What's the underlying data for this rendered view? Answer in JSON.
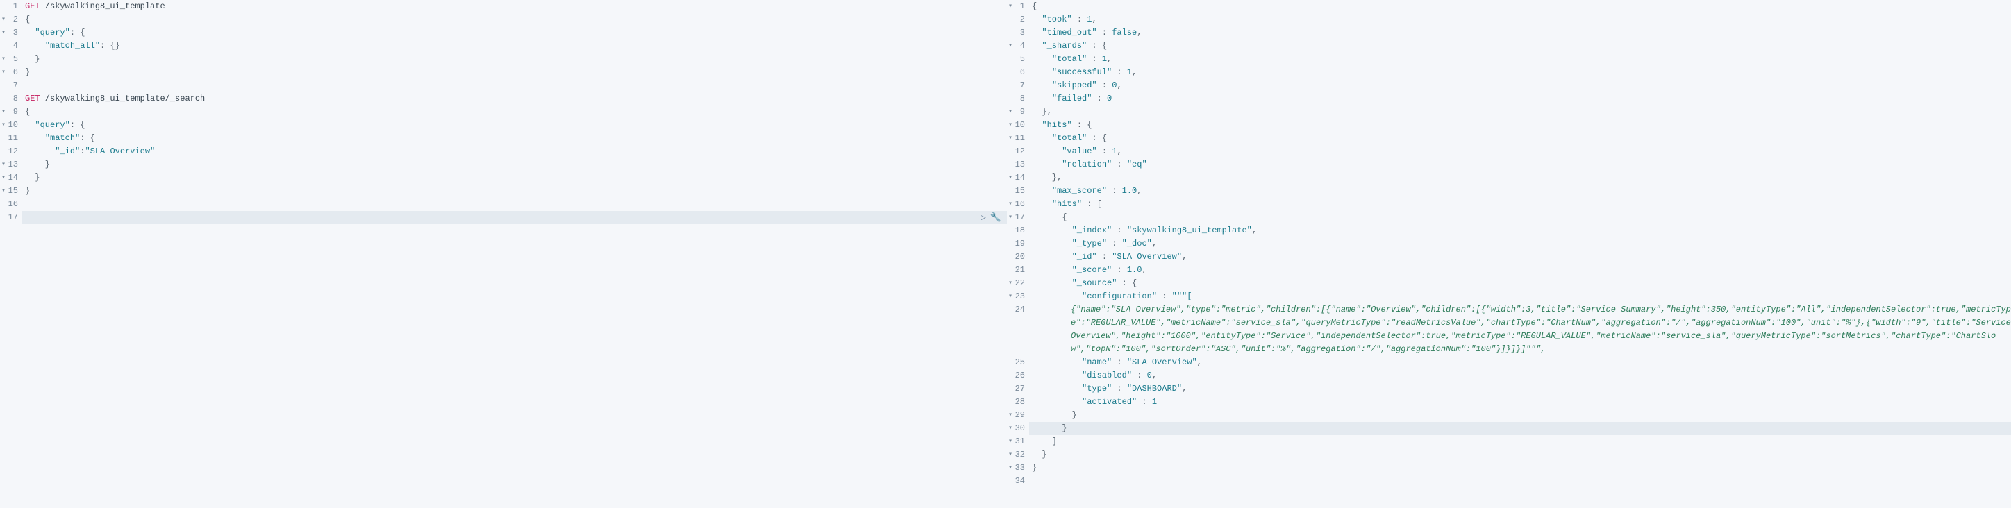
{
  "left": {
    "lines": [
      {
        "n": "1",
        "fold": "",
        "t": [
          [
            "method",
            "GET"
          ],
          [
            "path",
            " /skywalking8_ui_template"
          ]
        ]
      },
      {
        "n": "2",
        "fold": "▾",
        "t": [
          [
            "punct",
            "{"
          ]
        ]
      },
      {
        "n": "3",
        "fold": "▾",
        "t": [
          [
            "punct",
            "  "
          ],
          [
            "key",
            "\"query\""
          ],
          [
            "punct",
            ": {"
          ]
        ]
      },
      {
        "n": "4",
        "fold": "",
        "t": [
          [
            "punct",
            "    "
          ],
          [
            "key",
            "\"match_all\""
          ],
          [
            "punct",
            ": {}"
          ]
        ]
      },
      {
        "n": "5",
        "fold": "▾",
        "t": [
          [
            "punct",
            "  }"
          ]
        ]
      },
      {
        "n": "6",
        "fold": "▾",
        "t": [
          [
            "punct",
            "}"
          ]
        ]
      },
      {
        "n": "7",
        "fold": "",
        "t": []
      },
      {
        "n": "8",
        "fold": "",
        "t": [
          [
            "method",
            "GET"
          ],
          [
            "path",
            " /skywalking8_ui_template/_search"
          ]
        ]
      },
      {
        "n": "9",
        "fold": "▾",
        "t": [
          [
            "punct",
            "{"
          ]
        ]
      },
      {
        "n": "10",
        "fold": "▾",
        "t": [
          [
            "punct",
            "  "
          ],
          [
            "key",
            "\"query\""
          ],
          [
            "punct",
            ": {"
          ]
        ]
      },
      {
        "n": "11",
        "fold": "",
        "t": [
          [
            "punct",
            "    "
          ],
          [
            "key",
            "\"match\""
          ],
          [
            "punct",
            ": {"
          ]
        ]
      },
      {
        "n": "12",
        "fold": "",
        "t": [
          [
            "punct",
            "      "
          ],
          [
            "key",
            "\"_id\""
          ],
          [
            "punct",
            ":"
          ],
          [
            "string",
            "\"SLA Overview\""
          ]
        ]
      },
      {
        "n": "13",
        "fold": "▾",
        "t": [
          [
            "punct",
            "    }"
          ]
        ]
      },
      {
        "n": "14",
        "fold": "▾",
        "t": [
          [
            "punct",
            "  }"
          ]
        ]
      },
      {
        "n": "15",
        "fold": "▾",
        "t": [
          [
            "punct",
            "}"
          ]
        ]
      },
      {
        "n": "16",
        "fold": "",
        "t": []
      },
      {
        "n": "17",
        "fold": "",
        "t": []
      }
    ],
    "actions": {
      "play": "▷",
      "wrench": "🔧"
    }
  },
  "right": {
    "lines": [
      {
        "n": "1",
        "fold": "▾",
        "t": [
          [
            "punct",
            "{"
          ]
        ]
      },
      {
        "n": "2",
        "fold": "",
        "t": [
          [
            "punct",
            "  "
          ],
          [
            "key",
            "\"took\""
          ],
          [
            "punct",
            " : "
          ],
          [
            "num",
            "1"
          ],
          [
            "punct",
            ","
          ]
        ]
      },
      {
        "n": "3",
        "fold": "",
        "t": [
          [
            "punct",
            "  "
          ],
          [
            "key",
            "\"timed_out\""
          ],
          [
            "punct",
            " : "
          ],
          [
            "bool",
            "false"
          ],
          [
            "punct",
            ","
          ]
        ]
      },
      {
        "n": "4",
        "fold": "▾",
        "t": [
          [
            "punct",
            "  "
          ],
          [
            "key",
            "\"_shards\""
          ],
          [
            "punct",
            " : {"
          ]
        ]
      },
      {
        "n": "5",
        "fold": "",
        "t": [
          [
            "punct",
            "    "
          ],
          [
            "key",
            "\"total\""
          ],
          [
            "punct",
            " : "
          ],
          [
            "num",
            "1"
          ],
          [
            "punct",
            ","
          ]
        ]
      },
      {
        "n": "6",
        "fold": "",
        "t": [
          [
            "punct",
            "    "
          ],
          [
            "key",
            "\"successful\""
          ],
          [
            "punct",
            " : "
          ],
          [
            "num",
            "1"
          ],
          [
            "punct",
            ","
          ]
        ]
      },
      {
        "n": "7",
        "fold": "",
        "t": [
          [
            "punct",
            "    "
          ],
          [
            "key",
            "\"skipped\""
          ],
          [
            "punct",
            " : "
          ],
          [
            "num",
            "0"
          ],
          [
            "punct",
            ","
          ]
        ]
      },
      {
        "n": "8",
        "fold": "",
        "t": [
          [
            "punct",
            "    "
          ],
          [
            "key",
            "\"failed\""
          ],
          [
            "punct",
            " : "
          ],
          [
            "num",
            "0"
          ]
        ]
      },
      {
        "n": "9",
        "fold": "▾",
        "t": [
          [
            "punct",
            "  },"
          ]
        ]
      },
      {
        "n": "10",
        "fold": "▾",
        "t": [
          [
            "punct",
            "  "
          ],
          [
            "key",
            "\"hits\""
          ],
          [
            "punct",
            " : {"
          ]
        ]
      },
      {
        "n": "11",
        "fold": "▾",
        "t": [
          [
            "punct",
            "    "
          ],
          [
            "key",
            "\"total\""
          ],
          [
            "punct",
            " : {"
          ]
        ]
      },
      {
        "n": "12",
        "fold": "",
        "t": [
          [
            "punct",
            "      "
          ],
          [
            "key",
            "\"value\""
          ],
          [
            "punct",
            " : "
          ],
          [
            "num",
            "1"
          ],
          [
            "punct",
            ","
          ]
        ]
      },
      {
        "n": "13",
        "fold": "",
        "t": [
          [
            "punct",
            "      "
          ],
          [
            "key",
            "\"relation\""
          ],
          [
            "punct",
            " : "
          ],
          [
            "string",
            "\"eq\""
          ]
        ]
      },
      {
        "n": "14",
        "fold": "▾",
        "t": [
          [
            "punct",
            "    },"
          ]
        ]
      },
      {
        "n": "15",
        "fold": "",
        "t": [
          [
            "punct",
            "    "
          ],
          [
            "key",
            "\"max_score\""
          ],
          [
            "punct",
            " : "
          ],
          [
            "num",
            "1.0"
          ],
          [
            "punct",
            ","
          ]
        ]
      },
      {
        "n": "16",
        "fold": "▾",
        "t": [
          [
            "punct",
            "    "
          ],
          [
            "key",
            "\"hits\""
          ],
          [
            "punct",
            " : ["
          ]
        ]
      },
      {
        "n": "17",
        "fold": "▾",
        "t": [
          [
            "punct",
            "      {"
          ]
        ]
      },
      {
        "n": "18",
        "fold": "",
        "t": [
          [
            "punct",
            "        "
          ],
          [
            "key",
            "\"_index\""
          ],
          [
            "punct",
            " : "
          ],
          [
            "string",
            "\"skywalking8_ui_template\""
          ],
          [
            "punct",
            ","
          ]
        ]
      },
      {
        "n": "19",
        "fold": "",
        "t": [
          [
            "punct",
            "        "
          ],
          [
            "key",
            "\"_type\""
          ],
          [
            "punct",
            " : "
          ],
          [
            "string",
            "\"_doc\""
          ],
          [
            "punct",
            ","
          ]
        ]
      },
      {
        "n": "20",
        "fold": "",
        "t": [
          [
            "punct",
            "        "
          ],
          [
            "key",
            "\"_id\""
          ],
          [
            "punct",
            " : "
          ],
          [
            "string",
            "\"SLA Overview\""
          ],
          [
            "punct",
            ","
          ]
        ]
      },
      {
        "n": "21",
        "fold": "",
        "t": [
          [
            "punct",
            "        "
          ],
          [
            "key",
            "\"_score\""
          ],
          [
            "punct",
            " : "
          ],
          [
            "num",
            "1.0"
          ],
          [
            "punct",
            ","
          ]
        ]
      },
      {
        "n": "22",
        "fold": "▾",
        "t": [
          [
            "punct",
            "        "
          ],
          [
            "key",
            "\"_source\""
          ],
          [
            "punct",
            " : {"
          ]
        ]
      },
      {
        "n": "23",
        "fold": "▾",
        "t": [
          [
            "punct",
            "          "
          ],
          [
            "key",
            "\"configuration\""
          ],
          [
            "punct",
            " : "
          ],
          [
            "string",
            "\"\"\"["
          ]
        ]
      },
      {
        "n": "24",
        "fold": "",
        "wrap": true,
        "t": [
          [
            "italic-green",
            "{\"name\":\"SLA Overview\",\"type\":\"metric\",\"children\":[{\"name\":\"Overview\",\"children\":[{\"width\":3,\"title\":\"Service Summary\",\"height\":350,\"entityType\":\"All\",\"independentSelector\":true,\"metricType\":\"REGULAR_VALUE\",\"metricName\":\"service_sla\",\"queryMetricType\":\"readMetricsValue\",\"chartType\":\"ChartNum\",\"aggregation\":\"/\",\"aggregationNum\":\"100\",\"unit\":\"%\"},{\"width\":\"9\",\"title\":\"Service Overview\",\"height\":\"1000\",\"entityType\":\"Service\",\"independentSelector\":true,\"metricType\":\"REGULAR_VALUE\",\"metricName\":\"service_sla\",\"queryMetricType\":\"sortMetrics\",\"chartType\":\"ChartSlow\",\"topN\":\"100\",\"sortOrder\":\"ASC\",\"unit\":\"%\",\"aggregation\":\"/\",\"aggregationNum\":\"100\"}]}]}]\"\"\","
          ]
        ]
      },
      {
        "n": "25",
        "fold": "",
        "t": [
          [
            "punct",
            "          "
          ],
          [
            "key",
            "\"name\""
          ],
          [
            "punct",
            " : "
          ],
          [
            "string",
            "\"SLA Overview\""
          ],
          [
            "punct",
            ","
          ]
        ]
      },
      {
        "n": "26",
        "fold": "",
        "t": [
          [
            "punct",
            "          "
          ],
          [
            "key",
            "\"disabled\""
          ],
          [
            "punct",
            " : "
          ],
          [
            "num",
            "0"
          ],
          [
            "punct",
            ","
          ]
        ]
      },
      {
        "n": "27",
        "fold": "",
        "t": [
          [
            "punct",
            "          "
          ],
          [
            "key",
            "\"type\""
          ],
          [
            "punct",
            " : "
          ],
          [
            "string",
            "\"DASHBOARD\""
          ],
          [
            "punct",
            ","
          ]
        ]
      },
      {
        "n": "28",
        "fold": "",
        "t": [
          [
            "punct",
            "          "
          ],
          [
            "key",
            "\"activated\""
          ],
          [
            "punct",
            " : "
          ],
          [
            "num",
            "1"
          ]
        ]
      },
      {
        "n": "29",
        "fold": "▾",
        "t": [
          [
            "punct",
            "        }"
          ]
        ]
      },
      {
        "n": "30",
        "fold": "▾",
        "t": [
          [
            "punct",
            "      }"
          ]
        ]
      },
      {
        "n": "31",
        "fold": "▾",
        "t": [
          [
            "punct",
            "    ]"
          ]
        ]
      },
      {
        "n": "32",
        "fold": "▾",
        "t": [
          [
            "punct",
            "  }"
          ]
        ]
      },
      {
        "n": "33",
        "fold": "▾",
        "t": [
          [
            "punct",
            "}"
          ]
        ]
      },
      {
        "n": "34",
        "fold": "",
        "t": []
      }
    ]
  }
}
